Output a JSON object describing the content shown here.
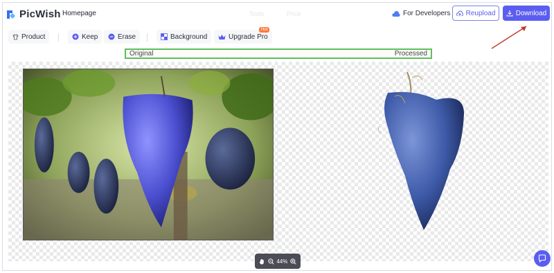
{
  "header": {
    "brand": "PicWish",
    "home_label": "Homepage",
    "faded_items": [
      "Tools",
      "Price"
    ],
    "developers_label": "For Developers",
    "reupload_label": "Reupload",
    "download_label": "Download"
  },
  "toolbar": {
    "product_label": "Product",
    "keep_label": "Keep",
    "erase_label": "Erase",
    "background_label": "Background",
    "upgrade_label": "Upgrade Pro",
    "hot_badge": "Hot"
  },
  "compare": {
    "original_label": "Original",
    "processed_label": "Processed"
  },
  "zoom": {
    "level": "44%"
  },
  "colors": {
    "accent": "#5b5df0",
    "highlight_border": "#5fbf58",
    "annotation_arrow": "#c0392b",
    "grape": "#4b4fd0"
  }
}
